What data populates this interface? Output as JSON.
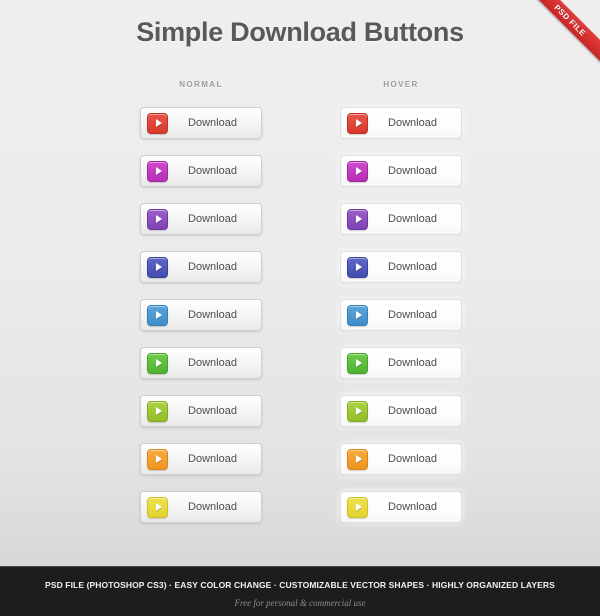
{
  "ribbon": {
    "label": "PSD FILE"
  },
  "header": {
    "title": "Simple Download Buttons",
    "columns": [
      {
        "key": "normal",
        "label": "NORMAL"
      },
      {
        "key": "hover",
        "label": "HOVER"
      }
    ]
  },
  "buttons": {
    "label": "Download",
    "icon": "play-icon",
    "rows": [
      {
        "color_name": "red",
        "icon_color": "#e8564a",
        "icon_color_dark": "#d6392c",
        "icon_border": "#c63024"
      },
      {
        "color_name": "magenta",
        "icon_color": "#cd4bcd",
        "icon_color_dark": "#b62fb6",
        "icon_border": "#a128a1"
      },
      {
        "color_name": "purple",
        "icon_color": "#9a5ec8",
        "icon_color_dark": "#8042b4",
        "icon_border": "#7038a3"
      },
      {
        "color_name": "blue-violet",
        "icon_color": "#5f67c6",
        "icon_color_dark": "#444cb0",
        "icon_border": "#3a429e"
      },
      {
        "color_name": "light-blue",
        "icon_color": "#5ea5da",
        "icon_color_dark": "#3d8cc9",
        "icon_border": "#357fb8"
      },
      {
        "color_name": "green",
        "icon_color": "#6dca4d",
        "icon_color_dark": "#4fb22f",
        "icon_border": "#45a027"
      },
      {
        "color_name": "yellow-green",
        "icon_color": "#aad243",
        "icon_color_dark": "#92bd28",
        "icon_border": "#83ab22"
      },
      {
        "color_name": "orange",
        "icon_color": "#f6ab40",
        "icon_color_dark": "#ef9420",
        "icon_border": "#dc861a"
      },
      {
        "color_name": "yellow",
        "icon_color": "#eee150",
        "icon_color_dark": "#e2d32f",
        "icon_border": "#cfc026"
      }
    ]
  },
  "footer": {
    "line1": "PSD FILE (PHOTOSHOP CS3) · EASY COLOR CHANGE · CUSTOMIZABLE VECTOR SHAPES · HIGHLY ORGANIZED LAYERS",
    "line2": "Free for personal & commercial use"
  }
}
